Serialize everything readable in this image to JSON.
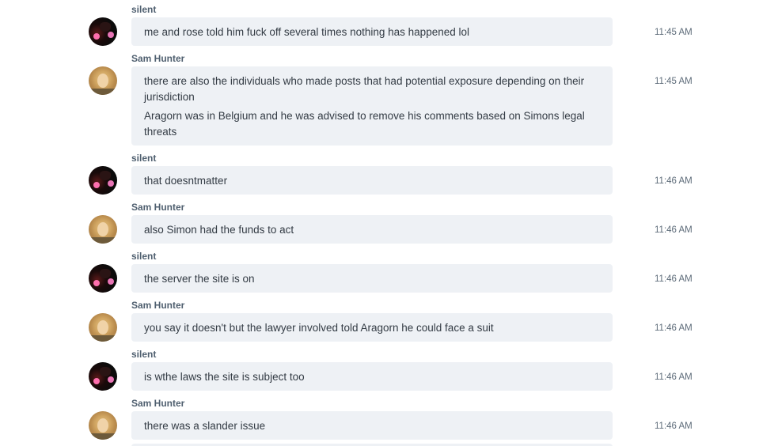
{
  "messages": [
    {
      "author": "silent",
      "avatar": "silent-avatar",
      "lines": [
        "me and rose told him fuck off several times nothing has happened lol"
      ],
      "time": "11:45 AM"
    },
    {
      "author": "Sam Hunter",
      "avatar": "sam-hunter-avatar",
      "lines": [
        "there are also the individuals who made posts that had potential exposure depending on their jurisdiction",
        "Aragorn was in Belgium and he was advised to remove his comments based on Simons legal threats"
      ],
      "time": "11:45 AM"
    },
    {
      "author": "silent",
      "avatar": "silent-avatar",
      "lines": [
        "that doesntmatter"
      ],
      "time": "11:46 AM"
    },
    {
      "author": "Sam Hunter",
      "avatar": "sam-hunter-avatar",
      "lines": [
        "also Simon had the funds to act"
      ],
      "time": "11:46 AM"
    },
    {
      "author": "silent",
      "avatar": "silent-avatar",
      "lines": [
        "the server the site is on"
      ],
      "time": "11:46 AM"
    },
    {
      "author": "Sam Hunter",
      "avatar": "sam-hunter-avatar",
      "lines": [
        "you say it doesn't but the lawyer involved told Aragorn he could face a suit"
      ],
      "time": "11:46 AM"
    },
    {
      "author": "silent",
      "avatar": "silent-avatar",
      "lines": [
        "is wthe laws the site is subject too"
      ],
      "time": "11:46 AM"
    },
    {
      "author": "Sam Hunter",
      "avatar": "sam-hunter-avatar",
      "lines": [
        "there was a slander issue"
      ],
      "time": "11:46 AM"
    }
  ]
}
